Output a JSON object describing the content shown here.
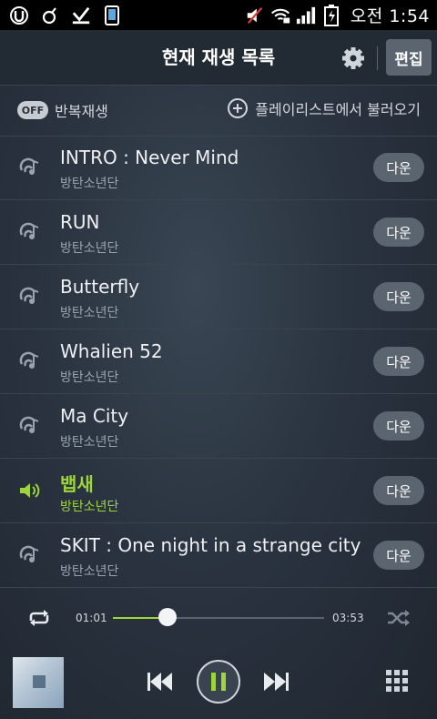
{
  "status_bar": {
    "time": "오전 1:54",
    "icons": [
      "u-plus-icon",
      "bell-icon",
      "check-icon",
      "phone-icon",
      "mute-icon",
      "wifi-icon",
      "signal-icon",
      "battery-icon"
    ]
  },
  "header": {
    "title": "현재 재생 목록",
    "edit_label": "편집"
  },
  "controls": {
    "repeat_badge": "OFF",
    "repeat_label": "반복재생",
    "load_playlist_label": "플레이리스트에서 불러오기"
  },
  "tracks": [
    {
      "title": "INTRO : Never Mind",
      "artist": "방탄소년단",
      "button": "다운",
      "active": false
    },
    {
      "title": "RUN",
      "artist": "방탄소년단",
      "button": "다운",
      "active": false
    },
    {
      "title": "Butterfly",
      "artist": "방탄소년단",
      "button": "다운",
      "active": false
    },
    {
      "title": "Whalien 52",
      "artist": "방탄소년단",
      "button": "다운",
      "active": false
    },
    {
      "title": "Ma City",
      "artist": "방탄소년단",
      "button": "다운",
      "active": false
    },
    {
      "title": "뱁새",
      "artist": "방탄소년단",
      "button": "다운",
      "active": true
    },
    {
      "title": "SKIT : One night in a strange city",
      "artist": "방탄소년단",
      "button": "다운",
      "active": false
    }
  ],
  "player": {
    "current_time": "01:01",
    "total_time": "03:53",
    "progress": 0.26
  },
  "colors": {
    "accent": "#9ed53a",
    "header_bg": "#222a33",
    "button_bg": "#5a6570"
  }
}
